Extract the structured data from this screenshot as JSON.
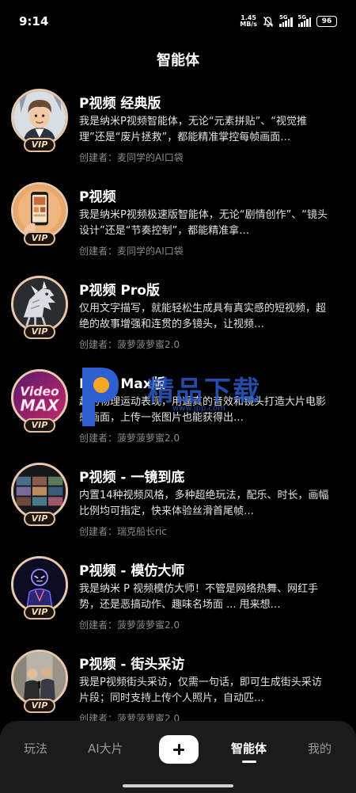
{
  "status": {
    "time": "9:14",
    "net_speed_value": "1.45",
    "net_speed_unit": "MB/s",
    "sim1": "5G",
    "sim2": "5G",
    "battery": "96",
    "icons": [
      "bell-off-icon",
      "signal-icon",
      "signal-icon",
      "battery-icon"
    ]
  },
  "header": {
    "title": "智能体"
  },
  "badge_label": "VIP",
  "agents": [
    {
      "title": "P视频 经典版",
      "desc": "我是纳米P视频智能体，无论“元素拼贴”、“视觉推理”还是“废片拯救”，都能精准掌控每帧画面…",
      "creator": "创建者：麦同学的AI口袋"
    },
    {
      "title": "P视频",
      "desc": "我是纳米P视频极速版智能体，无论“剧情创作”、“镜头设计”还是“节奏控制”，都能精准拿…",
      "creator": "创建者：麦同学的AI口袋"
    },
    {
      "title": "P视频 Pro版",
      "desc": "仅用文字描写，就能轻松生成具有真实感的短视频，超绝的故事增强和连贯的多镜头，让视频…",
      "creator": "创建者：菠萝菠萝蜜2.0"
    },
    {
      "title": "P视频 Max版",
      "desc": "越的物理运动表现，用逼真的音效和镜头打造大片电影感画面，上传一张图片也能获得出…",
      "creator": "创建者：菠萝菠萝蜜2.0"
    },
    {
      "title": "P视频 - 一镜到底",
      "desc": "内置14种视频风格，多种超绝玩法，配乐、时长，画幅比例均可指定，快来体验丝滑首尾帧…",
      "creator": "创建者：瑞克船长ric"
    },
    {
      "title": "P视频 - 模仿大师",
      "desc": "我是纳米 P 视频模仿大师！不管是网络热舞、网红手势，还是恶搞动作、趣味名场面 ... 甩来想…",
      "creator": "创建者：菠萝菠萝蜜2.0"
    },
    {
      "title": "P视频 - 街头采访",
      "desc": "我是P视频街头采访，仅需一句话，即可生成街头采访片段；同时支持上传个人照片，自动匹…",
      "creator": "创建者：菠萝菠萝蜜2.0"
    }
  ],
  "avatars": {
    "max_line1": "Video",
    "max_line2": "MAX"
  },
  "watermark": {
    "text": "精品下载",
    "url": "www.jpp.com"
  },
  "tabbar": {
    "tabs": [
      {
        "label": "玩法",
        "active": false
      },
      {
        "label": "AI大片",
        "active": false
      },
      {
        "label": "智能体",
        "active": true
      },
      {
        "label": "我的",
        "active": false
      }
    ],
    "plus_icon": "plus-icon"
  },
  "colors": {
    "background": "#000000",
    "vip_border": "#e2c09c",
    "creator_text": "#8a8a8a",
    "tabbar_bg": "#1b1b1b"
  }
}
